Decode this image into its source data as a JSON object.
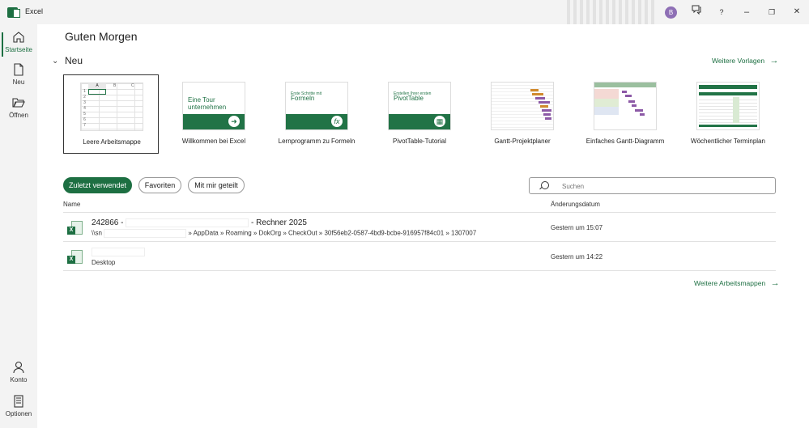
{
  "window": {
    "app_title": "Excel",
    "avatar_initial": "B",
    "help": "?",
    "minimize": "–",
    "maximize": "❐",
    "close": "✕"
  },
  "sidebar": {
    "items": [
      {
        "label": "Startseite",
        "icon": "home-icon"
      },
      {
        "label": "Neu",
        "icon": "new-file-icon"
      },
      {
        "label": "Öffnen",
        "icon": "folder-open-icon"
      }
    ],
    "bottom": [
      {
        "label": "Konto",
        "icon": "account-icon"
      },
      {
        "label": "Optionen",
        "icon": "options-icon"
      }
    ]
  },
  "main": {
    "greeting": "Guten Morgen",
    "new_section": {
      "title": "Neu",
      "more_templates": "Weitere Vorlagen"
    },
    "templates": [
      {
        "label": "Leere Arbeitsmappe",
        "thumb_text": ""
      },
      {
        "label": "Willkommen bei Excel",
        "thumb_text": "Eine Tour unternehmen"
      },
      {
        "label": "Lernprogramm zu Formeln",
        "thumb_small": "Erste Schritte mit",
        "thumb_big": "Formeln"
      },
      {
        "label": "PivotTable-Tutorial",
        "thumb_small": "Erstellen Ihrer ersten",
        "thumb_big": "PivotTable"
      },
      {
        "label": "Gantt-Projektplaner"
      },
      {
        "label": "Einfaches Gantt-Diagramm"
      },
      {
        "label": "Wöchentlicher Terminplan"
      }
    ],
    "grid_cols": [
      "A",
      "B",
      "C"
    ],
    "grid_rows": [
      "1",
      "2",
      "3",
      "4",
      "5",
      "6",
      "7"
    ],
    "filters": [
      "Zuletzt verwendet",
      "Favoriten",
      "Mit mir geteilt"
    ],
    "search_placeholder": "Suchen",
    "columns": {
      "name": "Name",
      "date": "Änderungsdatum"
    },
    "files": [
      {
        "name_prefix": "242866 -",
        "name_suffix": "- Rechner 2025",
        "path_prefix": "\\\\sn",
        "path_suffix": "» AppData » Roaming » DokOrg » CheckOut » 30f56eb2-0587-4bd9-bcbe-916957f84c01 » 1307007",
        "date": "Gestern um 15:07"
      },
      {
        "name_prefix": "",
        "name_suffix": "",
        "path_prefix": "Desktop",
        "path_suffix": "",
        "date": "Gestern um 14:22"
      }
    ],
    "more_workbooks": "Weitere Arbeitsmappen"
  }
}
